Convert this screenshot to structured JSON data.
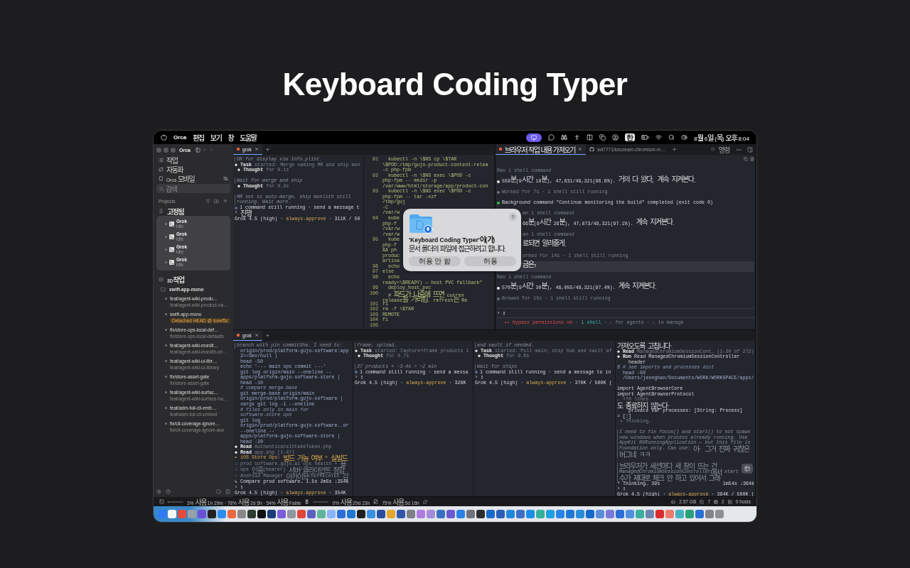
{
  "title": "Keyboard Coding Typer",
  "menu_bar": {
    "app": "Orca",
    "menus": [
      "편집",
      "보기",
      "창",
      "도움말"
    ],
    "input_source": "한",
    "clock": "8월 6일 (목) 오후 8:04"
  },
  "sidebar": {
    "window_title": "Orca",
    "nav": [
      {
        "kind": "tasks",
        "label": "작업"
      },
      {
        "kind": "automation",
        "label": "자동화"
      },
      {
        "kind": "mobile",
        "label": "Orca 모바일"
      }
    ],
    "search": {
      "placeholder": "검색"
    },
    "projects_label": "Projects",
    "pinned": {
      "label": "고정됨",
      "sessions": [
        {
          "name": "Grok",
          "status": "idle"
        },
        {
          "name": "Grok",
          "status": "idle"
        },
        {
          "name": "Grok",
          "status": "idle"
        },
        {
          "name": "Grok",
          "status": "idle"
        }
      ]
    },
    "group": {
      "label": "3D작업",
      "repo": "swift-app-mono",
      "worktrees": [
        {
          "name": "feat/agent-wiki-produ…",
          "branch": "feat/agent-wiki-product-na…"
        },
        {
          "name": "swift-app-mono",
          "badge": "Detached HEAD @ tceef5c"
        },
        {
          "name": "fix/store-ops-local-def…",
          "branch": "fix/store-ops-local-defaults"
        },
        {
          "name": "feat/agent-wiki-monlit…",
          "branch": "feat/agent-wiki-monlith-sh…"
        },
        {
          "name": "feat/agent-wiki-ui-libr…",
          "branch": "feat/agent-wiki-ui-library"
        },
        {
          "name": "fix/store-asset-gate",
          "branch": "fix/store-asset-gate"
        },
        {
          "name": "feat/agent-wiki-surfac…",
          "branch": "feat/agent-wiki-surface-ha…"
        },
        {
          "name": "feat/adm-full-cli-emb…",
          "branch": "feat/adm-full-cli-embed"
        },
        {
          "name": "fix/cli-coverage-ignore…",
          "branch": "fix/cli-coverage-ignore-aux"
        }
      ]
    }
  },
  "top_tabs": [
    {
      "label": "grok",
      "selected": true
    }
  ],
  "top_left_pane": {
    "lines": [
      {
        "kind": "quote",
        "text": "OK for display via Info.plist."
      },
      {
        "kind": "parts",
        "parts": [
          {
            "kind": "bold",
            "text": "◆ Task"
          },
          {
            "kind": "dim",
            "text": " started: Merge naming MR and ship mon"
          }
        ]
      },
      {
        "kind": "parts",
        "parts": [
          {
            "kind": "bold",
            "text": " ◆ Thought"
          },
          {
            "kind": "dim",
            "text": " for 0.1s"
          }
        ]
      },
      {
        "kind": "gap"
      },
      {
        "kind": "quote",
        "text": "Wait for merge and ship"
      },
      {
        "kind": "parts",
        "parts": [
          {
            "kind": "bold",
            "text": " ◆ Thought"
          },
          {
            "kind": "dim",
            "text": " for 0.2s"
          }
        ]
      },
      {
        "kind": "gap"
      },
      {
        "kind": "quote",
        "text": "MR set to auto-merge, ship monlith still"
      },
      {
        "kind": "quote",
        "text": "running. Wait more."
      },
      {
        "kind": "text",
        "color": "#5a6b8c",
        "text": "1 command still running · send a message t"
      },
      {
        "kind": "text",
        "text": "› 진행"
      },
      {
        "kind": "parts",
        "parts": [
          {
            "kind": "text",
            "text": "Grok 4.5 (high) · "
          },
          {
            "kind": "yellow",
            "text": "always-approve"
          },
          {
            "kind": "text",
            "text": " · 311K / 50"
          }
        ]
      }
    ]
  },
  "code_pane": {
    "lines": [
      {
        "number": "91",
        "rows": [
          "  kubectl -n \\$NS cp \\$TAR",
          "\\$POD:/tmp/gujo-product-content-relea",
          "-c php-fpm"
        ]
      },
      {
        "number": "92",
        "rows": [
          "  kubectl -n \\$NS exec \\$POD -c",
          "php-fpm -- mkdir -p",
          "/var/www/html/storage/app/product-con"
        ]
      },
      {
        "number": "93",
        "rows": [
          "  kubectl -n \\$NS exec \\$POD -c",
          "php-fpm -- tar -xzf",
          "/tmp/guj",
          "-C",
          "/var/w"
        ]
      },
      {
        "number": "94",
        "rows": [
          "  kube",
          "php-f",
          "/var/w",
          "/var/w"
        ]
      },
      {
        "number": "95",
        "rows": [
          "  kube",
          "php-f",
          "&& ph",
          "produc",
          "artisa"
        ]
      },
      {
        "number": "96",
        "rows": [
          "  echo"
        ]
      },
      {
        "number": "97",
        "rows": [
          "else"
        ]
      },
      {
        "number": "98",
        "rows": [
          "  echo",
          "ready=\\$READY) — host PVC fallback\""
        ]
      },
      {
        "number": "99",
        "rows": [
          "  deploy_host_pvc"
        ]
      },
      {
        "number": "100",
        "rows": [
          "  # 파드가 나중에 뜨면 curren",
          "release를 가리킴. refresh는 Re"
        ]
      },
      {
        "number": "101",
        "rows": [
          "fi"
        ]
      },
      {
        "number": "102",
        "rows": [
          "rm -f \\$TAR"
        ]
      },
      {
        "number": "103",
        "rows": [
          "REMOTE"
        ]
      },
      {
        "number": "104",
        "rows": [
          "fi"
        ]
      },
      {
        "number": "105"
      }
    ]
  },
  "dialog": {
    "title": "'Keyboard Coding Typer'이(가)",
    "message": "문서 폴더의 파일에 접근하려고 합니다.",
    "help": "?",
    "buttons": [
      "허용 안 함",
      "허용"
    ]
  },
  "right_pane": {
    "tabs": [
      {
        "label": "브라우저 작업 내용 가져오기",
        "kind": "session",
        "selected": true
      },
      {
        "label": "avi7771/icecream-chromium-m…",
        "kind": "repo",
        "selected": false
      }
    ],
    "run_label": "명령",
    "lines": [
      {
        "kind": "dim",
        "text": "Ran 1 shell command"
      },
      {
        "kind": "text",
        "color": "#e8e8e8",
        "text": "559분(9시간 19분), 47,631/49,321(96.6%). 거의 다 왔다, 계속 지켜본다."
      },
      {
        "kind": "dim",
        "color": "#6b7280",
        "text": "Worked for 7s · 1 shell still running"
      },
      {
        "kind": "text",
        "color": "#3fb950",
        "text": "Background command \"Continue monitoring the build\" completed (exit code 0)"
      },
      {
        "kind": "clipdim",
        "text": "an 1 shell command"
      },
      {
        "kind": "clip",
        "text": "66분(9시간 26분), 47,873/49,321(97.1%). 계속 지켜본다."
      },
      {
        "kind": "clipdim",
        "text": "an 1 shell command"
      },
      {
        "kind": "clip",
        "text": "료되면 알려줄게."
      },
      {
        "kind": "clipdim",
        "text": "orked for 14s · 1 shell still running"
      },
      {
        "kind": "user",
        "text": "금은?"
      },
      {
        "kind": "dim",
        "text": "Ran 1 shell command"
      },
      {
        "kind": "text",
        "color": "#e8e8e8",
        "text": "570분(9시간 30분), 48,055/49,321(97.4%). 계속 지켜본다."
      },
      {
        "kind": "dim",
        "color": "#6b7280",
        "text": "Brewed for 10s · 1 shell still running"
      }
    ],
    "prompt": "› ▯",
    "footer": [
      {
        "kind": "red",
        "text": "•• bypass permissions on"
      },
      {
        "kind": "dim",
        "text": " · "
      },
      {
        "kind": "teal",
        "text": "1 shell"
      },
      {
        "kind": "dim",
        "text": " · ← for agents · ↓ to manage"
      }
    ]
  },
  "bottom_tabs": [
    {
      "label": "grok",
      "selected": true
    }
  ],
  "bottom_panes": [
    {
      "lines": [
        {
          "kind": "quote",
          "text": "branch with pin commitSha. I need to:"
        },
        {
          "kind": "code",
          "text": "  origin/prod/platform-gujo-software:app"
        },
        {
          "kind": "code",
          "text": "  2>/dev/null |"
        },
        {
          "kind": "code",
          "text": "  head -50"
        },
        {
          "kind": "code",
          "text": "  echo '--- main ops commit ---'"
        },
        {
          "kind": "code",
          "text": "  git log origin/main --oneline --"
        },
        {
          "kind": "code",
          "text": "  apps/platform-gujo-software-store |"
        },
        {
          "kind": "code",
          "text": "  head -10"
        },
        {
          "kind": "comment",
          "text": "  # compare merge-base"
        },
        {
          "kind": "code",
          "text": "  git merge-base origin/main"
        },
        {
          "kind": "code",
          "text": "  origin/prod/platform-gujo-software |"
        },
        {
          "kind": "code",
          "text": "  xargs git log -1 --oneline"
        },
        {
          "kind": "comment",
          "text": "  # files only in main for"
        },
        {
          "kind": "comment",
          "text": "  software-store ops"
        },
        {
          "kind": "code",
          "text": "  git log"
        },
        {
          "kind": "code",
          "text": "  origin/prod/platform-gujo-software..or"
        },
        {
          "kind": "code",
          "text": "  --oneline --"
        },
        {
          "kind": "code",
          "text": "  apps/platform-gujo-software-store |"
        },
        {
          "kind": "code",
          "text": "  head -20"
        },
        {
          "kind": "parts",
          "parts": [
            {
              "kind": "bold",
              "text": "◆ Read"
            },
            {
              "kind": "dim",
              "text": " AuthenticateIntakeToken.php"
            }
          ]
        },
        {
          "kind": "parts",
          "parts": [
            {
              "kind": "bold",
              "text": "◆ Read"
            },
            {
              "kind": "dim",
              "text": " app.php (1-47)"
            }
          ]
        },
        {
          "kind": "yellow",
          "text": "▸ iOS Store Ops: 빌드 가능 여부 + 실빌드"
        },
        {
          "kind": "dim",
          "text": "☐ prod software.gujo.ai ops health + 플"
        },
        {
          "kind": "dim",
          "text": "☐ ops 인증(bearer) 서버/클라이언트 정합"
        },
        {
          "kind": "dim",
          "text": "☐ Android Manager 아카이브/DEPRECATED 감"
        },
        {
          "kind": "text",
          "text": "↳ Compare prod software… 1.5s 2m5s ↓354k"
        },
        {
          "kind": "text",
          "text": "› ▯"
        },
        {
          "kind": "parts",
          "parts": [
            {
              "kind": "text",
              "text": "Grok 4.5 (high) · "
            },
            {
              "kind": "yellow",
              "text": "always-approve"
            },
            {
              "kind": "text",
              "text": " · 354K"
            }
          ]
        }
      ]
    },
    {
      "lines": [
        {
          "kind": "quote",
          "text": "frame, upload."
        },
        {
          "kind": "parts",
          "parts": [
            {
              "kind": "bold",
              "text": "◆ Task"
            },
            {
              "kind": "dim",
              "text": " started: Capture+frame products 1"
            }
          ]
        },
        {
          "kind": "parts",
          "parts": [
            {
              "kind": "bold",
              "text": " ◆ Thought"
            },
            {
              "kind": "dim",
              "text": " for 0.7s"
            }
          ]
        },
        {
          "kind": "gap"
        },
        {
          "kind": "quote",
          "text": "37 products × ~3-4s = ~2 min"
        },
        {
          "kind": "text",
          "color": "#5a6b8c",
          "text": "1 command still running · send a messa"
        },
        {
          "kind": "text",
          "text": "› ▯"
        },
        {
          "kind": "parts",
          "parts": [
            {
              "kind": "text",
              "text": "Grok 4.5 (high) · "
            },
            {
              "kind": "yellow",
              "text": "always-approve"
            },
            {
              "kind": "text",
              "text": " · 328K"
            }
          ]
        }
      ]
    },
    {
      "lines": [
        {
          "kind": "quote",
          "text": "and vault if needed."
        },
        {
          "kind": "parts",
          "parts": [
            {
              "kind": "bold",
              "text": "◆ Task"
            },
            {
              "kind": "dim",
              "text": " started: Pull main; ship hub and vault af"
            }
          ]
        },
        {
          "kind": "parts",
          "parts": [
            {
              "kind": "bold",
              "text": " ◆ Thought"
            },
            {
              "kind": "dim",
              "text": " for 0.6s"
            }
          ]
        },
        {
          "kind": "gap"
        },
        {
          "kind": "quote",
          "text": "Wait for ships"
        },
        {
          "kind": "text",
          "color": "#5a6b8c",
          "text": "1 command still running · send a message to in"
        },
        {
          "kind": "text",
          "text": "› ▯"
        },
        {
          "kind": "parts",
          "parts": [
            {
              "kind": "text",
              "text": "Grok 4.5 (high) · "
            },
            {
              "kind": "yellow",
              "text": "always-approve"
            },
            {
              "kind": "text",
              "text": " · 370K / 500K ("
            }
          ]
        }
      ]
    },
    {
      "lines": [
        {
          "kind": "text",
          "text": "가져오도록 고칩니다."
        },
        {
          "kind": "parts",
          "parts": [
            {
              "kind": "bold",
              "text": "◆ Read"
            },
            {
              "kind": "dim",
              "text": " ManagedChromiumSessionCont… (1-30 of 272)"
            }
          ]
        },
        {
          "kind": "parts",
          "parts": [
            {
              "kind": "bold",
              "text": "◆ Run"
            },
            {
              "kind": "text",
              "text": " Read ManagedChromiumSessionController"
            }
          ]
        },
        {
          "kind": "text",
          "text": "    header"
        },
        {
          "kind": "comment",
          "text": "$ # see imports and processes dict"
        },
        {
          "kind": "code",
          "text": "  head -50"
        },
        {
          "kind": "code",
          "text": "  /Users/jeonghan/Documents/WORK/WORKSPACE/apps/"
        },
        {
          "kind": "gap"
        },
        {
          "kind": "text",
          "text": "import AgentBrowserCore"
        },
        {
          "kind": "text",
          "text": "import AgentBrowserProtocol"
        },
        {
          "kind": "dim",
          "text": "… +70 lines"
        },
        {
          "kind": "text",
          "text": "도 종료하지 않는다."
        },
        {
          "kind": "text",
          "text": "    private var processes: [String: Process]"
        },
        {
          "kind": "text",
          "text": "= [:]"
        },
        {
          "kind": "dim",
          "text": " ✳ Thinking…"
        },
        {
          "kind": "gap"
        },
        {
          "kind": "quote",
          "text": "I need to fix focus() and start() to not spawn"
        },
        {
          "kind": "quote",
          "text": "new windows when process already running. Use"
        },
        {
          "kind": "quote",
          "text": "AppKit NSRunningApplication — but this file is"
        },
        {
          "kind": "quote",
          "text": "Foundation only. Can use: 아, 그거 진짜 귀찮은"
        },
        {
          "kind": "quote",
          "text": "버그네 ㅋㅋ"
        },
        {
          "kind": "gap"
        },
        {
          "kind": "quote",
          "text": "브라우저가 세션마다 새 창이 뜨는 건"
        },
        {
          "kind": "quote",
          "text": "ManagedChromiumSessionController에서 start"
        },
        {
          "kind": "quote",
          "text": "수가 제대로 체크 안 하고 있어서 그래."
        },
        {
          "kind": "text",
          "text": "* Thinking… 39s",
          "right": "1m54s ↓364k"
        },
        {
          "kind": "text",
          "text": "› ▯"
        },
        {
          "kind": "parts",
          "parts": [
            {
              "kind": "text",
              "text": "Grok 4.5 (high) · "
            },
            {
              "kind": "yellow",
              "text": "always-approve"
            },
            {
              "kind": "text",
              "text": " · 364K / 500K ("
            }
          ]
        }
      ]
    }
  ],
  "status_bar": {
    "segments": [
      {
        "kind": "meter",
        "level": 0.03,
        "text": "3% 사용 1h 29m · 78% 사용 2d 5h · 54% 사용 Fable"
      },
      {
        "kind": "track",
        "text": "0% 사용 29d 23h"
      },
      {
        "kind": "plain",
        "text": "75% 사용 5d 16h"
      }
    ],
    "right": [
      {
        "kind": "memory",
        "text": "2.57 GB"
      },
      {
        "kind": "terminals",
        "text": "7"
      },
      {
        "kind": "cpu",
        "text": "2"
      },
      {
        "kind": "hosts",
        "text": "0 hosts"
      }
    ]
  }
}
